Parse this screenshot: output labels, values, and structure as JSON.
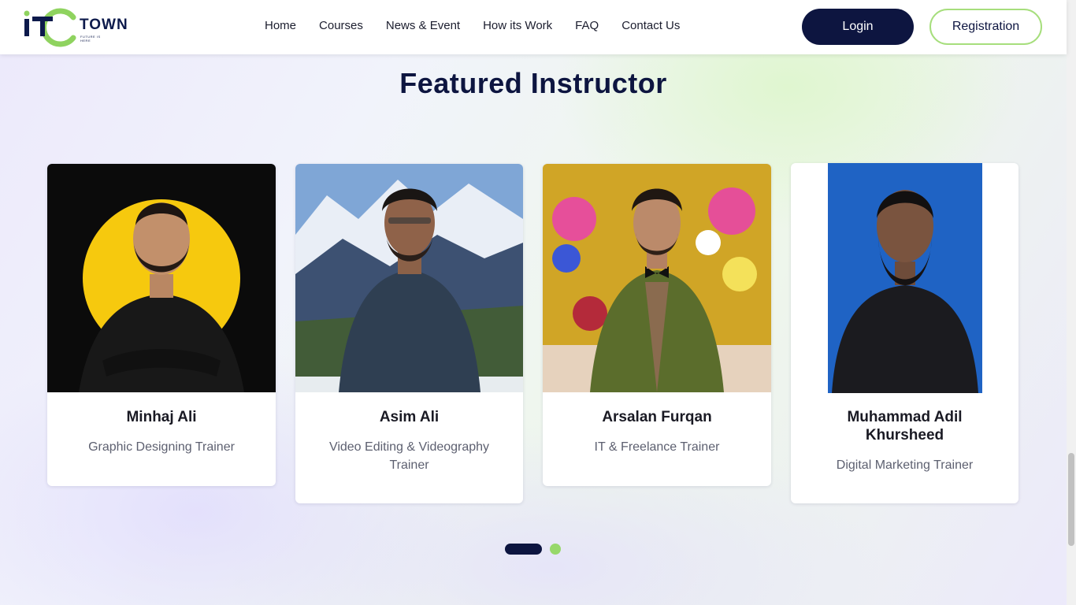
{
  "brand": {
    "logo_letters": "IT",
    "name": "TOWN",
    "tagline": "FUTURE IS HERE"
  },
  "nav": {
    "items": [
      "Home",
      "Courses",
      "News & Event",
      "How its Work",
      "FAQ",
      "Contact Us"
    ]
  },
  "auth": {
    "login_label": "Login",
    "register_label": "Registration"
  },
  "section": {
    "title": "Featured Instructor"
  },
  "instructors": [
    {
      "name": "Minhaj Ali",
      "role": "Graphic Designing Trainer",
      "photo_icon": "person-photo-yellow-circle-backdrop"
    },
    {
      "name": "Asim Ali",
      "role": "Video Editing & Videography Trainer",
      "photo_icon": "person-photo-mountain-backdrop"
    },
    {
      "name": "Arsalan Furqan",
      "role": "IT & Freelance Trainer",
      "photo_icon": "person-photo-floral-backdrop"
    },
    {
      "name": "Muhammad Adil Khursheed",
      "role": "Digital Marketing Trainer",
      "photo_icon": "person-photo-blue-backdrop"
    }
  ],
  "carousel": {
    "total_pages": 2,
    "current_page": 1
  },
  "colors": {
    "primary": "#0d1540",
    "accent": "#97d86a"
  }
}
